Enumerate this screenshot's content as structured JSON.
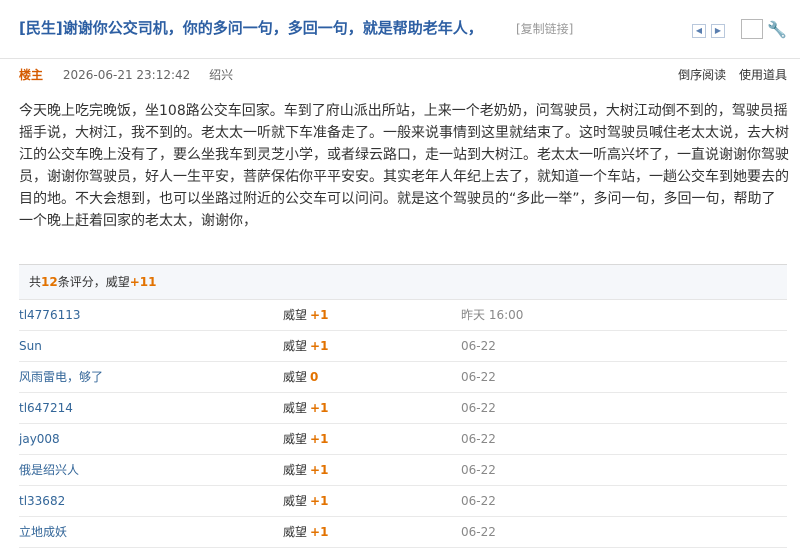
{
  "header": {
    "title": "[民生]谢谢你公交司机，你的多问一句，多回一句，就是帮助老年人，",
    "copy_link": "[复制链接]",
    "prev_icon": "◀",
    "next_icon": "▶",
    "wrench_glyph": "🔧"
  },
  "meta": {
    "author_label": "楼主",
    "datetime": "2026-06-21 23:12:42",
    "location": "绍兴",
    "reverse_read": "倒序阅读",
    "use_tool": "使用道具"
  },
  "post": {
    "content": "今天晚上吃完晚饭，坐108路公交车回家。车到了府山派出所站，上来一个老奶奶，问驾驶员，大树江动倒不到的，驾驶员摇摇手说，大树江，我不到的。老太太一听就下车准备走了。一般来说事情到这里就结束了。这时驾驶员喊住老太太说，去大树江的公交车晚上没有了，要么坐我车到灵芝小学，或者绿云路口，走一站到大树江。老太太一听高兴坏了，一直说谢谢你驾驶员，谢谢你驾驶员，好人一生平安，菩萨保佑你平平安安。其实老年人年纪上去了，就知道一个车站，一趟公交车到她要去的目的地。不大会想到，也可以坐路过附近的公交车可以问问。就是这个驾驶员的“多此一举”，多问一句，多回一句，帮助了一个晚上赶着回家的老太太，谢谢你，"
  },
  "ratings": {
    "summary_prefix": "共",
    "count": "12",
    "summary_mid": "条评分，",
    "total_label": "威望",
    "total_value": "+11",
    "rows": [
      {
        "user": "tl4776113",
        "label": "威望",
        "value": "+1",
        "date": "昨天 16:00"
      },
      {
        "user": "Sun",
        "label": "威望",
        "value": "+1",
        "date": "06-22"
      },
      {
        "user": "风雨雷电，够了",
        "label": "威望",
        "value": "0",
        "date": "06-22"
      },
      {
        "user": "tl647214",
        "label": "威望",
        "value": "+1",
        "date": "06-22"
      },
      {
        "user": "jay008",
        "label": "威望",
        "value": "+1",
        "date": "06-22"
      },
      {
        "user": "俄是绍兴人",
        "label": "威望",
        "value": "+1",
        "date": "06-22"
      },
      {
        "user": "tl33682",
        "label": "威望",
        "value": "+1",
        "date": "06-22"
      },
      {
        "user": "立地成妖",
        "label": "威望",
        "value": "+1",
        "date": "06-22"
      }
    ]
  },
  "colors": {
    "title": "#2d5fa3",
    "accent": "#e27200",
    "link": "#336699"
  }
}
